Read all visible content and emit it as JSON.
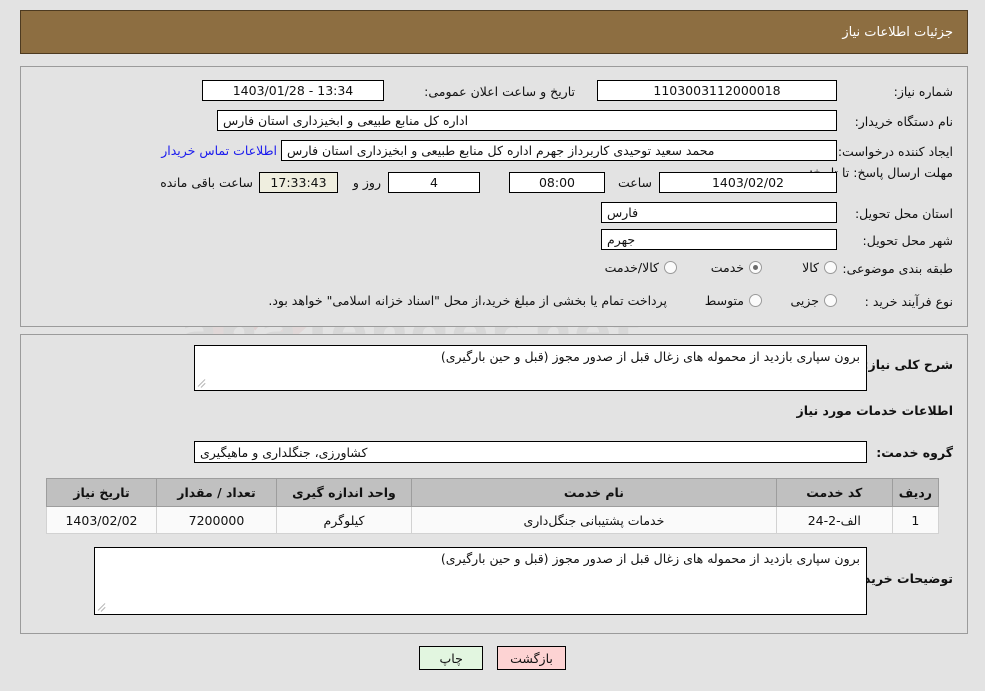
{
  "header": {
    "title": "جزئیات اطلاعات نیاز"
  },
  "colors": {
    "header_bg": "#8d6e41",
    "page_bg": "#e3e3e3",
    "link": "#1a1aee",
    "timer_bg": "#efeedf",
    "back_btn_bg": "#fdd3d3",
    "print_btn_bg": "#e2f6e0",
    "table_header_bg": "#c0c0c0"
  },
  "watermark": {
    "text": "anaTender.net"
  },
  "details": {
    "need_number_label": "شماره نیاز:",
    "need_number_value": "1103003112000018",
    "announce_datetime_label": "تاریخ و ساعت اعلان عمومی:",
    "announce_datetime_value": "1403/01/28 - 13:34",
    "buyer_org_label": "نام دستگاه خریدار:",
    "buyer_org_value": "اداره کل منابع طبیعی و ابخیزداری استان فارس",
    "creator_label": "ایجاد کننده درخواست:",
    "creator_value": "محمد سعید توحیدی کاربرداز جهرم اداره کل منابع طبیعی و ابخیزداری استان فارس",
    "buyer_contact_link": "اطلاعات تماس خریدار",
    "deadline_label": "مهلت ارسال پاسخ: تا تاریخ:",
    "deadline_date": "1403/02/02",
    "deadline_hour_label": "ساعت",
    "deadline_hour": "08:00",
    "remaining_days": "4",
    "remaining_days_suffix": "روز و",
    "remaining_timer": "17:33:43",
    "remaining_suffix": "ساعت باقی مانده",
    "province_label": "استان محل تحویل:",
    "province_value": "فارس",
    "city_label": "شهر محل تحویل:",
    "city_value": "جهرم",
    "category_label": "طبقه بندی موضوعی:",
    "category_options": [
      {
        "label": "کالا",
        "selected": false
      },
      {
        "label": "خدمت",
        "selected": true
      },
      {
        "label": "کالا/خدمت",
        "selected": false
      }
    ],
    "process_label": "نوع فرآیند خرید :",
    "process_options": [
      {
        "label": "جزیی",
        "selected": false
      },
      {
        "label": "متوسط",
        "selected": false
      }
    ],
    "treasury_checkbox_label": "پرداخت تمام یا بخشی از مبلغ خرید،از محل \"اسناد خزانه اسلامی\" خواهد بود.",
    "treasury_checked": false
  },
  "body": {
    "general_desc_label": "شرح کلی نیاز:",
    "general_desc_value": "برون سپاری بازدید از محموله های زغال قبل از صدور مجوز (قبل و حین بارگیری)",
    "services_section_title": "اطلاعات خدمات مورد نیاز",
    "service_group_label": "گروه خدمت:",
    "service_group_value": "کشاورزی، جنگلداری و ماهیگیری",
    "buyer_notes_label": "توضیحات خریدار:",
    "buyer_notes_value": "برون سپاری بازدید از محموله های زغال قبل از صدور مجوز (قبل و حین بارگیری)"
  },
  "table": {
    "columns": [
      "ردیف",
      "کد خدمت",
      "نام خدمت",
      "واحد اندازه گیری",
      "تعداد / مقدار",
      "تاریخ نیاز"
    ],
    "rows": [
      {
        "row_no": "1",
        "service_code": "الف-2-24",
        "service_name": "خدمات پشتیبانی جنگل‌داری",
        "unit": "کیلوگرم",
        "quantity": "7200000",
        "need_date": "1403/02/02"
      }
    ]
  },
  "footer": {
    "print_label": "چاپ",
    "back_label": "بازگشت"
  }
}
